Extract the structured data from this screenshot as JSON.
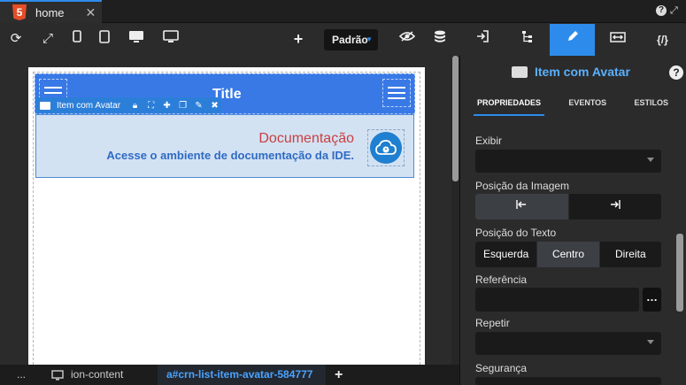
{
  "tabs": {
    "home_label": "home"
  },
  "toolbar": {
    "mode_label": "Padrão"
  },
  "canvas": {
    "header_title": "Title",
    "selection_label": "Item com Avatar",
    "item_title": "Documentação",
    "item_subtitle": "Acesse o ambiente de documentação da IDE."
  },
  "breadcrumb": {
    "ellipsis": "...",
    "parent": "ion-content",
    "current": "a#crn-list-item-avatar-584777"
  },
  "panel": {
    "component_name": "Item com Avatar",
    "subtabs": [
      "PROPRIEDADES",
      "EVENTOS",
      "ESTILOS"
    ],
    "labels": {
      "exibir": "Exibir",
      "posicao_imagem": "Posição da Imagem",
      "posicao_texto": "Posição do Texto",
      "referencia": "Referência",
      "repetir": "Repetir",
      "seguranca": "Segurança"
    },
    "text_positions": [
      "Esquerda",
      "Centro",
      "Direita"
    ],
    "text_position_selected": "Centro",
    "image_position_selected": "left"
  },
  "colors": {
    "accent": "#2d8ceb",
    "header": "#3979e6",
    "item_title": "#c94040",
    "item_subtitle": "#2f6bc4"
  }
}
